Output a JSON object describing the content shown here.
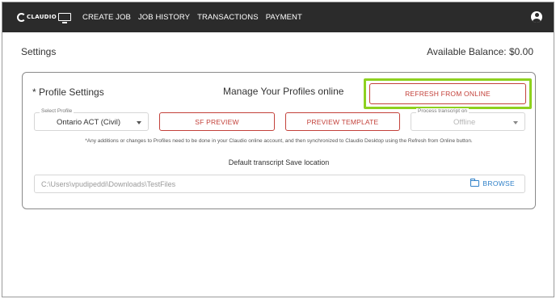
{
  "app": {
    "logo_text": "CLAUDIO"
  },
  "nav": {
    "items": [
      {
        "label": "CREATE JOB"
      },
      {
        "label": "JOB HISTORY"
      },
      {
        "label": "TRANSACTIONS"
      },
      {
        "label": "PAYMENT"
      }
    ]
  },
  "page": {
    "title": "Settings",
    "balance": "Available Balance: $0.00"
  },
  "profile_settings": {
    "title": "* Profile Settings",
    "manage_title": "Manage Your Profiles online",
    "refresh_button": "REFRESH FROM ONLINE",
    "select_profile": {
      "legend": "Select Profile",
      "value": "Ontario ACT (Civil)"
    },
    "sf_preview_button": "SF PREVIEW",
    "preview_template_button": "PREVIEW TEMPLATE",
    "process_transcript": {
      "legend": "Process transcript on",
      "value": "Offline"
    },
    "note": "*Any additions or changes to Profiles need to be done in your Claudio online account, and then synchronized to Claudio Desktop using the Refresh from Online button.",
    "save_location_title": "Default transcript Save location",
    "save_location_value": "C:\\Users\\vpudipeddi\\Downloads\\TestFiles",
    "browse_button": "BROWSE"
  },
  "colors": {
    "topbar": "#2b2b2b",
    "accent_red": "#c3413a",
    "highlight_green": "#8ed11f",
    "link_blue": "#2f80c8"
  },
  "icons": {
    "account": "account-circle-icon",
    "folder": "folder-icon",
    "dropdown": "chevron-down-icon"
  }
}
